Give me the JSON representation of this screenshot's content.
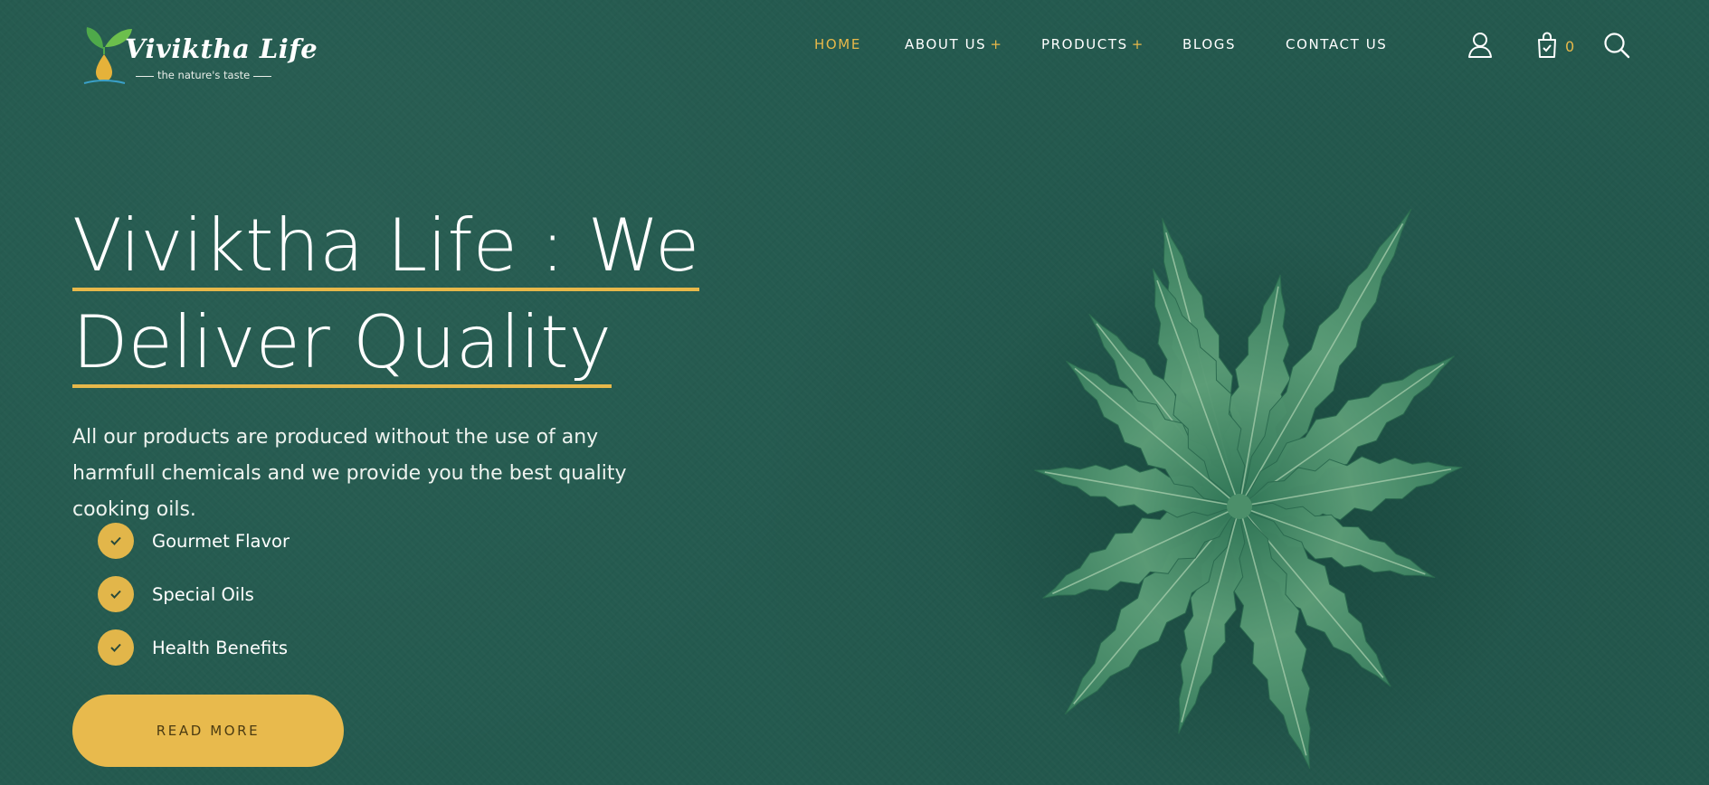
{
  "brand": {
    "name": "Viviktha Life",
    "tagline": "the nature's taste"
  },
  "nav": {
    "items": [
      {
        "label": "HOME",
        "active": true,
        "has_submenu": false
      },
      {
        "label": "ABOUT US",
        "active": false,
        "has_submenu": true
      },
      {
        "label": "PRODUCTS",
        "active": false,
        "has_submenu": true
      },
      {
        "label": "BLOGS",
        "active": false,
        "has_submenu": false
      },
      {
        "label": "CONTACT US",
        "active": false,
        "has_submenu": false
      }
    ],
    "submenu_indicator": "+"
  },
  "header_actions": {
    "account_icon": "user-icon",
    "cart_icon": "shopping-bag-icon",
    "cart_count": "0",
    "search_icon": "search-icon"
  },
  "hero": {
    "title_line1": "Viviktha Life : We",
    "title_line2": "Deliver Quality",
    "description": "All our products are produced without the use of any harmfull chemicals and we provide you the best quality cooking oils.",
    "features": [
      "Gourmet Flavor",
      "Special Oils",
      "Health Benefits"
    ],
    "cta_label": "READ MORE"
  },
  "colors": {
    "background": "#245a4f",
    "accent": "#e7b84a",
    "text": "#ffffff",
    "leaf": "#3f8a66"
  }
}
